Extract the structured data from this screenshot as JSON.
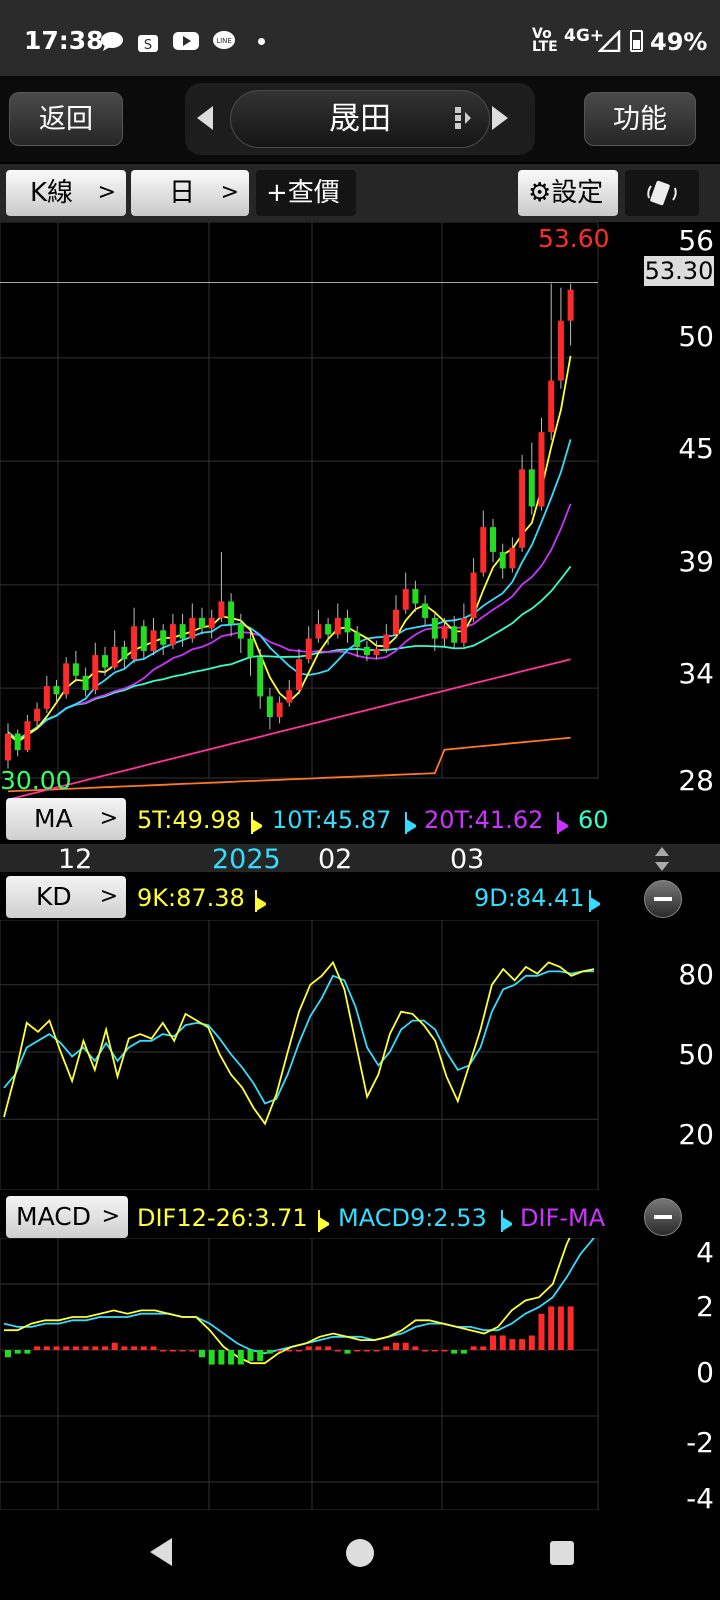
{
  "status": {
    "time": "17:38",
    "network": "Vo LTE",
    "signal": "4G+",
    "battery": "49%"
  },
  "header": {
    "back": "返回",
    "stock": "晟田",
    "func": "功能"
  },
  "toolbar": {
    "kline": "K線",
    "period": "日",
    "query": "+查價",
    "settings": "⚙設定"
  },
  "main": {
    "high_label": "53.60",
    "current_price": "53.30",
    "low_label": "30.00",
    "yticks": [
      "56",
      "50",
      "45",
      "39",
      "34",
      "28"
    ]
  },
  "ma_bar": {
    "tag": "MA",
    "ma5": "5T:49.98",
    "ma10": "10T:45.87",
    "ma20": "20T:41.62",
    "ma60": "60"
  },
  "date_axis": {
    "labels": [
      "12",
      "2025",
      "02",
      "03"
    ]
  },
  "kd": {
    "tag": "KD",
    "k": "9K:87.38",
    "d": "9D:84.41",
    "yticks": [
      "80",
      "50",
      "20"
    ]
  },
  "macd": {
    "tag": "MACD",
    "dif": "DIF12-26:3.71",
    "macd9": "MACD9:2.53",
    "diff": "DIF-MA",
    "yticks": [
      "4",
      "2",
      "0",
      "-2",
      "-4"
    ]
  },
  "colors": {
    "up": "#ff2a2a",
    "down": "#22dd22",
    "ma5": "#ffff33",
    "ma10": "#33ddff",
    "ma20": "#cc33ff",
    "ma60": "#33ffcc",
    "ma120": "#ff3399",
    "ma240": "#ff7722"
  },
  "chart_data": {
    "type": "candlestick",
    "price_range": [
      28,
      56
    ],
    "candles": [
      [
        30.5,
        31.8,
        32.3,
        30.1
      ],
      [
        31.8,
        31.0,
        32.0,
        30.7
      ],
      [
        31.0,
        32.4,
        32.7,
        30.9
      ],
      [
        32.4,
        33.0,
        33.3,
        32.1
      ],
      [
        33.0,
        34.1,
        34.6,
        32.8
      ],
      [
        34.1,
        33.7,
        34.4,
        33.3
      ],
      [
        33.7,
        35.2,
        35.5,
        33.5
      ],
      [
        35.2,
        34.6,
        35.8,
        34.3
      ],
      [
        34.6,
        33.9,
        35.0,
        33.6
      ],
      [
        33.9,
        35.6,
        36.2,
        33.7
      ],
      [
        35.6,
        35.0,
        36.0,
        34.6
      ],
      [
        35.0,
        36.0,
        36.8,
        34.9
      ],
      [
        36.0,
        35.4,
        36.3,
        34.9
      ],
      [
        35.4,
        37.0,
        37.9,
        35.2
      ],
      [
        37.0,
        35.8,
        37.3,
        35.4
      ],
      [
        35.8,
        36.8,
        37.4,
        35.6
      ],
      [
        36.8,
        36.1,
        37.1,
        35.6
      ],
      [
        36.1,
        37.1,
        37.6,
        35.9
      ],
      [
        37.1,
        36.4,
        37.6,
        36.0
      ],
      [
        36.4,
        37.4,
        38.1,
        36.2
      ],
      [
        37.4,
        36.9,
        37.9,
        36.6
      ],
      [
        36.9,
        37.4,
        37.8,
        36.4
      ],
      [
        37.4,
        38.2,
        40.6,
        37.2
      ],
      [
        38.2,
        37.1,
        38.6,
        36.5
      ],
      [
        37.1,
        36.4,
        37.6,
        35.7
      ],
      [
        36.4,
        35.5,
        36.7,
        34.6
      ],
      [
        35.5,
        33.6,
        35.9,
        33.0
      ],
      [
        33.6,
        32.6,
        34.0,
        32.0
      ],
      [
        32.6,
        33.3,
        33.6,
        32.3
      ],
      [
        33.3,
        33.9,
        34.4,
        33.1
      ],
      [
        33.9,
        35.4,
        35.9,
        33.7
      ],
      [
        35.4,
        36.4,
        37.0,
        35.2
      ],
      [
        36.4,
        37.1,
        37.8,
        36.2
      ],
      [
        37.1,
        36.6,
        37.4,
        36.1
      ],
      [
        36.6,
        37.4,
        38.1,
        36.4
      ],
      [
        37.4,
        36.7,
        37.8,
        36.2
      ],
      [
        36.7,
        36.0,
        37.0,
        35.5
      ],
      [
        36.0,
        35.6,
        36.3,
        35.3
      ],
      [
        35.6,
        35.9,
        36.3,
        35.4
      ],
      [
        35.9,
        36.6,
        37.1,
        35.7
      ],
      [
        36.6,
        37.8,
        38.5,
        36.4
      ],
      [
        37.8,
        38.8,
        39.6,
        37.6
      ],
      [
        38.8,
        38.1,
        39.2,
        37.7
      ],
      [
        38.1,
        37.4,
        38.5,
        37.0
      ],
      [
        37.4,
        36.4,
        37.6,
        35.8
      ],
      [
        36.4,
        37.0,
        37.4,
        36.0
      ],
      [
        37.0,
        36.2,
        37.5,
        35.9
      ],
      [
        36.2,
        37.4,
        38.1,
        36.0
      ],
      [
        37.4,
        39.6,
        40.3,
        37.2
      ],
      [
        39.6,
        41.8,
        42.6,
        39.4
      ],
      [
        41.8,
        40.6,
        42.2,
        40.1
      ],
      [
        40.6,
        39.8,
        41.0,
        39.3
      ],
      [
        39.8,
        40.8,
        41.3,
        39.6
      ],
      [
        40.8,
        44.6,
        45.3,
        40.6
      ],
      [
        44.6,
        42.8,
        45.9,
        42.4
      ],
      [
        42.8,
        46.4,
        47.1,
        42.6
      ],
      [
        46.4,
        48.9,
        53.6,
        46.0
      ],
      [
        48.9,
        51.8,
        53.4,
        48.5
      ],
      [
        51.8,
        53.3,
        53.6,
        50.6
      ]
    ],
    "ma_series": {
      "ma5": "yellow",
      "ma10": "cyan",
      "ma20": "purple",
      "ma60": "teal",
      "ma120": "pink",
      "ma240": "orange"
    }
  }
}
